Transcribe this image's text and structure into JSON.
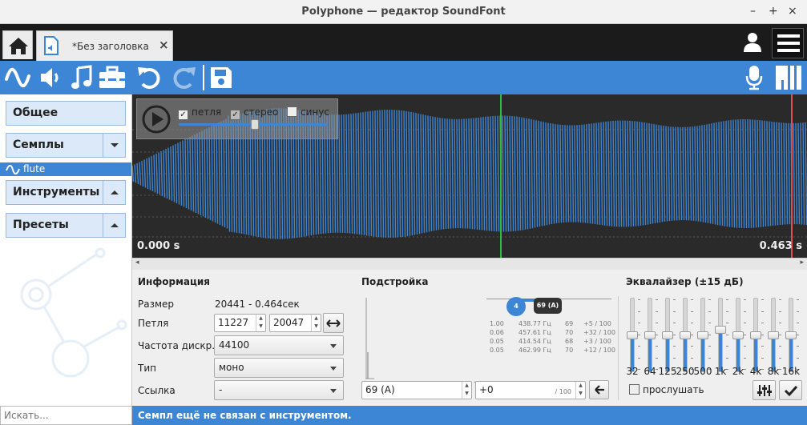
{
  "window": {
    "title": "Polyphone — редактор SoundFont",
    "controls": [
      "–",
      "+",
      "×"
    ]
  },
  "tabs": {
    "home_icon": "home-icon",
    "doc_label": "*Без заголовка",
    "close": "×"
  },
  "toolbar": {
    "left_icons": [
      "waveform-icon",
      "speaker-icon",
      "music-note-icon",
      "toolbox-icon",
      "undo-icon",
      "redo-icon",
      "save-icon"
    ],
    "right_icons": [
      "microphone-icon",
      "piano-icon"
    ]
  },
  "sidebar": {
    "general": "Общее",
    "samples": "Семплы",
    "sample_item": "flute",
    "instruments": "Инструменты",
    "presets": "Пресеты",
    "search_placeholder": "Искать..."
  },
  "waveform": {
    "loop_label": "петля",
    "loop_checked": true,
    "stereo_label": "стерео",
    "stereo_checked": true,
    "sine_label": "синус",
    "sine_checked": false,
    "start_time": "0.000 s",
    "end_time": "0.463 s",
    "waveform_color": "#3d86d5",
    "loop_start_marker_color": "#2ebd3d",
    "loop_end_marker_color": "#e05050"
  },
  "info": {
    "heading": "Информация",
    "size_label": "Размер",
    "size_value": "20441 - 0.464сек",
    "loop_label": "Петля",
    "loop_start": "11227",
    "loop_end": "20047",
    "rate_label": "Частота дискр...",
    "rate_value": "44100",
    "type_label": "Тип",
    "type_value": "моно",
    "link_label": "Ссылка",
    "link_value": "-"
  },
  "tuning": {
    "heading": "Подстройка",
    "badge_left": "4",
    "badge_right": "69 (A)",
    "rows": [
      [
        "1.00",
        "438.77 Гц",
        "69",
        "+5 / 100"
      ],
      [
        "0.06",
        "457.61 Гц",
        "70",
        "+32 / 100"
      ],
      [
        "0.05",
        "414.54 Гц",
        "68",
        "+3 / 100"
      ],
      [
        "0.05",
        "462.99 Гц",
        "70",
        "+12 / 100"
      ]
    ],
    "root_key": "69 (A)",
    "correction": "+0",
    "correction_suffix": "/ 100"
  },
  "equalizer": {
    "heading": "Эквалайзер (±15 дБ)",
    "bands": [
      "32",
      "64",
      "125",
      "250",
      "500",
      "1k",
      "2k",
      "4k",
      "8k",
      "16k"
    ],
    "gains": [
      0,
      0,
      0,
      0,
      0,
      2,
      0,
      0,
      0,
      0
    ],
    "listen_label": "прослушать",
    "listen_checked": false
  },
  "status": {
    "message": "Семпл ещё не связан с инструментом."
  }
}
